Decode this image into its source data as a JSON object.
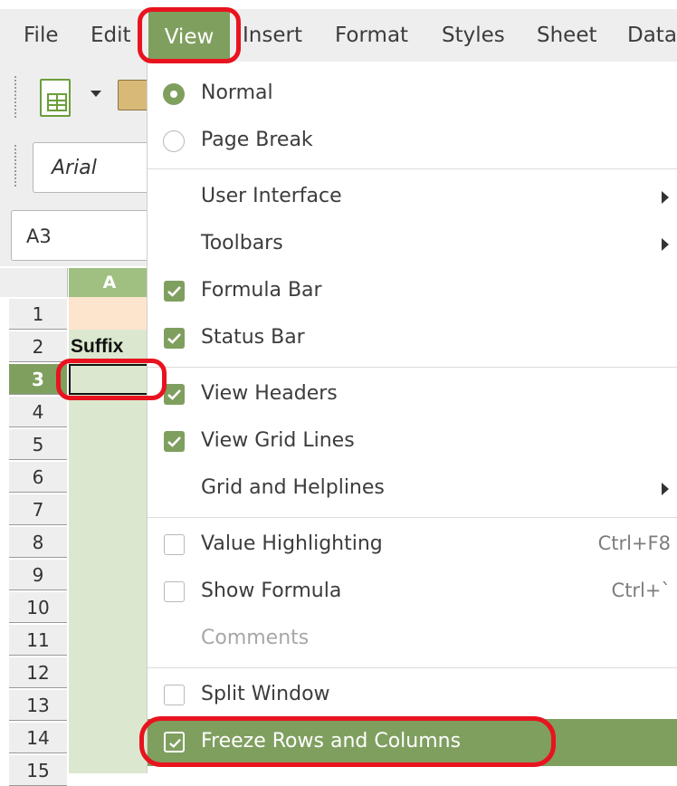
{
  "menubar": {
    "items": [
      "File",
      "Edit",
      "View",
      "Insert",
      "Format",
      "Styles",
      "Sheet",
      "Data"
    ],
    "active_index": 2
  },
  "toolbar": {
    "font_name": "Arial",
    "name_box": "A3"
  },
  "sheet": {
    "column_header": "A",
    "rows": [
      "1",
      "2",
      "3",
      "4",
      "5",
      "6",
      "7",
      "8",
      "9",
      "10",
      "11",
      "12",
      "13",
      "14",
      "15"
    ],
    "selected_row": "3",
    "cell_a2": "Suffix"
  },
  "view_menu": {
    "items": [
      {
        "label": "Normal",
        "control": "radio-on"
      },
      {
        "label": "Page Break",
        "control": "radio-off"
      },
      {
        "label": "User Interface",
        "submenu": true
      },
      {
        "label": "Toolbars",
        "submenu": true
      },
      {
        "label": "Formula Bar",
        "control": "check-on"
      },
      {
        "label": "Status Bar",
        "control": "check-on"
      },
      {
        "label": "View Headers",
        "control": "check-on"
      },
      {
        "label": "View Grid Lines",
        "control": "check-on"
      },
      {
        "label": "Grid and Helplines",
        "submenu": true
      },
      {
        "label": "Value Highlighting",
        "control": "check-off",
        "shortcut": "Ctrl+F8"
      },
      {
        "label": "Show Formula",
        "control": "check-off",
        "shortcut": "Ctrl+`"
      },
      {
        "label": "Comments",
        "disabled": true
      },
      {
        "label": "Split Window",
        "control": "check-off"
      },
      {
        "label": "Freeze Rows and Columns",
        "control": "check-on",
        "highlighted": true
      }
    ]
  },
  "colors": {
    "accent": "#7f9f5f",
    "annotation": "#e8131f",
    "selected_column_fill": "#dbe8cf"
  }
}
